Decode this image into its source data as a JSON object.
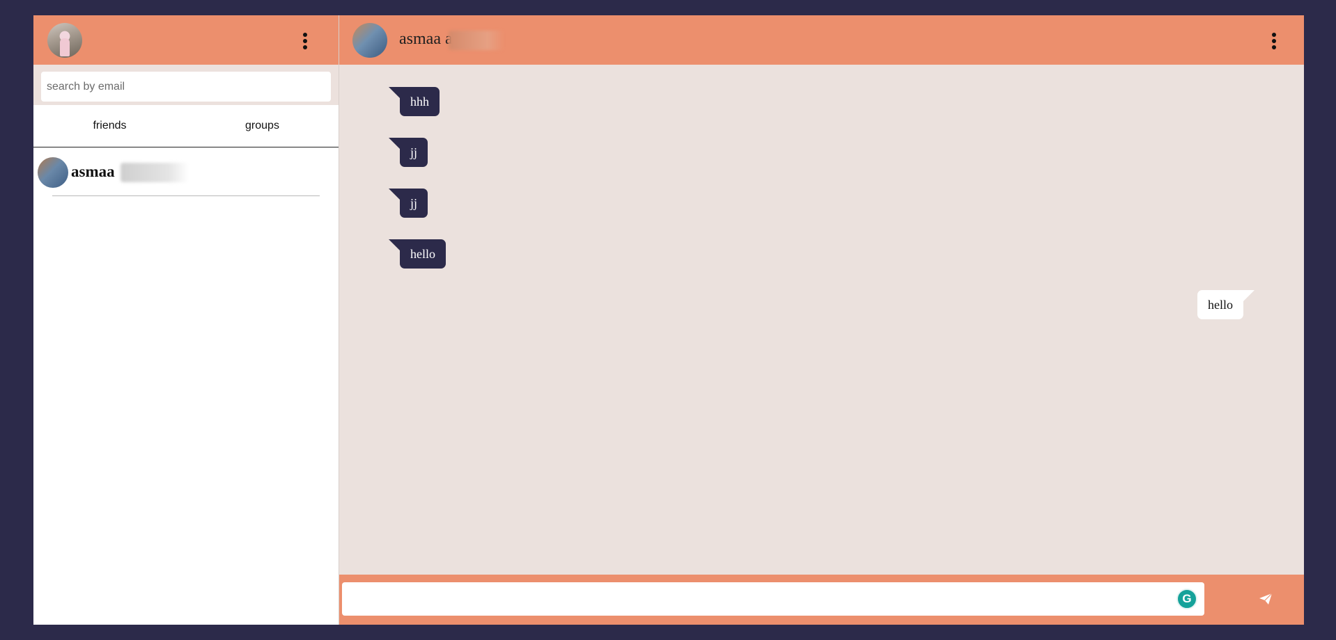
{
  "sidebar": {
    "search": {
      "placeholder": "search by email",
      "value": ""
    },
    "tabs": [
      {
        "label": "friends"
      },
      {
        "label": "groups"
      }
    ],
    "contacts": [
      {
        "name": "asmaa"
      }
    ]
  },
  "chat": {
    "contact_name": "asmaa a",
    "messages": [
      {
        "text": "hhh",
        "direction": "incoming"
      },
      {
        "text": "jj",
        "direction": "incoming"
      },
      {
        "text": "jj",
        "direction": "incoming"
      },
      {
        "text": "hello",
        "direction": "incoming"
      },
      {
        "text": "hello",
        "direction": "outgoing"
      }
    ],
    "composer": {
      "value": "",
      "grammarly_glyph": "G"
    }
  },
  "colors": {
    "background": "#2c2a4a",
    "header": "#ec8f6d",
    "chat_bg": "#ebe1dd",
    "incoming_bubble": "#2c2a4a",
    "outgoing_bubble": "#ffffff",
    "grammarly": "#15a29a"
  },
  "icons": {
    "menu": "vertical-dots-icon",
    "send": "paper-plane-icon",
    "grammarly": "grammarly-icon"
  }
}
